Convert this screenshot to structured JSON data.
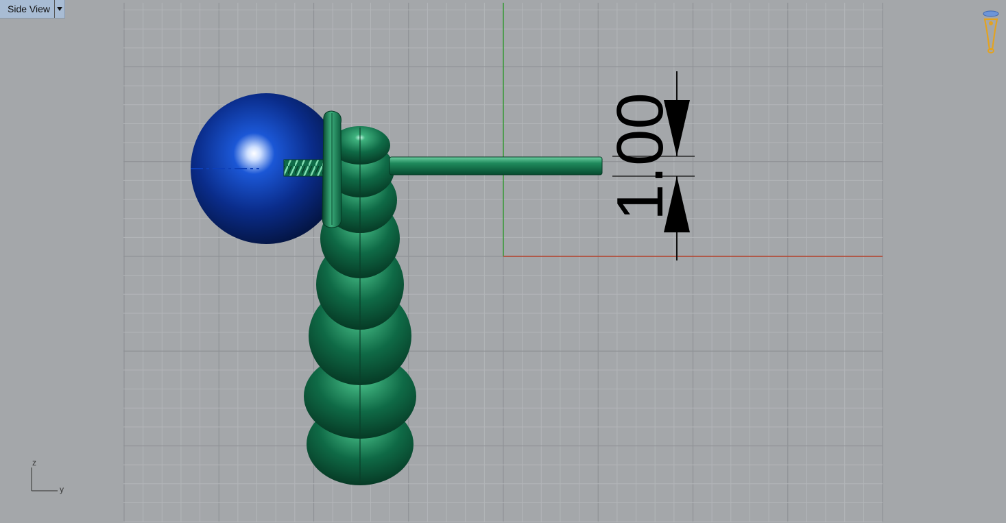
{
  "viewport": {
    "title": "Side View",
    "dropdown_icon": "caret-down-icon"
  },
  "dimension": {
    "value_text": "1.00"
  },
  "axis_widget": {
    "vertical_label": "z",
    "horizontal_label": "y"
  },
  "navigation_widget_icon": "camera-view-icon",
  "colors": {
    "background": "#a4a7aa",
    "grid_minor": "#b3b6b9",
    "grid_major": "#8f9296",
    "axis_green": "#3b9a3b",
    "axis_red": "#b6412b",
    "model_green": "#0f6b48",
    "sphere_blue": "#0b2f8a",
    "label_bg": "#a8bcd4"
  }
}
